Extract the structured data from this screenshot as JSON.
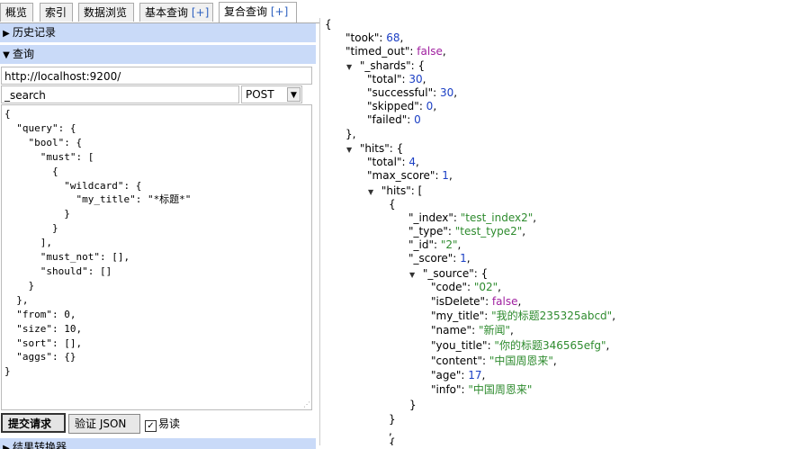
{
  "tabs": [
    {
      "label": "概览",
      "plus": ""
    },
    {
      "label": "索引",
      "plus": ""
    },
    {
      "label": "数据浏览",
      "plus": ""
    },
    {
      "label": "基本查询 ",
      "plus": "[+]"
    },
    {
      "label": "复合查询 ",
      "plus": "[+]"
    }
  ],
  "sidebar": {
    "history_label": "历史记录",
    "query_label": "查询",
    "results_label": "结果转换器"
  },
  "query": {
    "url": "http://localhost:9200/",
    "path": "_search",
    "method": "POST",
    "body": "{\n  \"query\": {\n    \"bool\": {\n      \"must\": [\n        {\n          \"wildcard\": {\n            \"my_title\": \"*标题*\"\n          }\n        }\n      ],\n      \"must_not\": [],\n      \"should\": []\n    }\n  },\n  \"from\": 0,\n  \"size\": 10,\n  \"sort\": [],\n  \"aggs\": {}\n}",
    "submit_label": "提交请求",
    "validate_label": "验证 JSON",
    "easy_read_label": "易读",
    "easy_read_checked": true
  },
  "response": {
    "open_brace": "{",
    "took_key": "\"took\"",
    "took": "68",
    "timed_out_key": "\"timed_out\"",
    "timed_out": "false",
    "shards_key": "\"_shards\"",
    "shards_total_key": "\"total\"",
    "shards_total": "30",
    "shards_successful_key": "\"successful\"",
    "shards_successful": "30",
    "shards_skipped_key": "\"skipped\"",
    "shards_skipped": "0",
    "shards_failed_key": "\"failed\"",
    "shards_failed": "0",
    "hits_key": "\"hits\"",
    "hits_total_key": "\"total\"",
    "hits_total": "4",
    "max_score_key": "\"max_score\"",
    "max_score": "1",
    "hits_arr_key": "\"hits\"",
    "index_key": "\"_index\"",
    "index": "\"test_index2\"",
    "type_key": "\"_type\"",
    "type": "\"test_type2\"",
    "id_key": "\"_id\"",
    "id": "\"2\"",
    "score_key": "\"_score\"",
    "score": "1",
    "source_key": "\"_source\"",
    "code_key": "\"code\"",
    "code": "\"02\"",
    "isdelete_key": "\"isDelete\"",
    "isdelete": "false",
    "my_title_key": "\"my_title\"",
    "my_title": "\"我的标题235325abcd\"",
    "name_key": "\"name\"",
    "name": "\"新闻\"",
    "you_title_key": "\"you_title\"",
    "you_title": "\"你的标题346565efg\"",
    "content_key": "\"content\"",
    "content": "\"中国周恩来\"",
    "age_key": "\"age\"",
    "age": "17",
    "info_key": "\"info\"",
    "info": "\"中国周恩来\""
  },
  "colors": {
    "accordion_bg": "#c9daf8",
    "string": "#2e8b2e",
    "number": "#1a3ec4",
    "boolean": "#a020a0"
  }
}
